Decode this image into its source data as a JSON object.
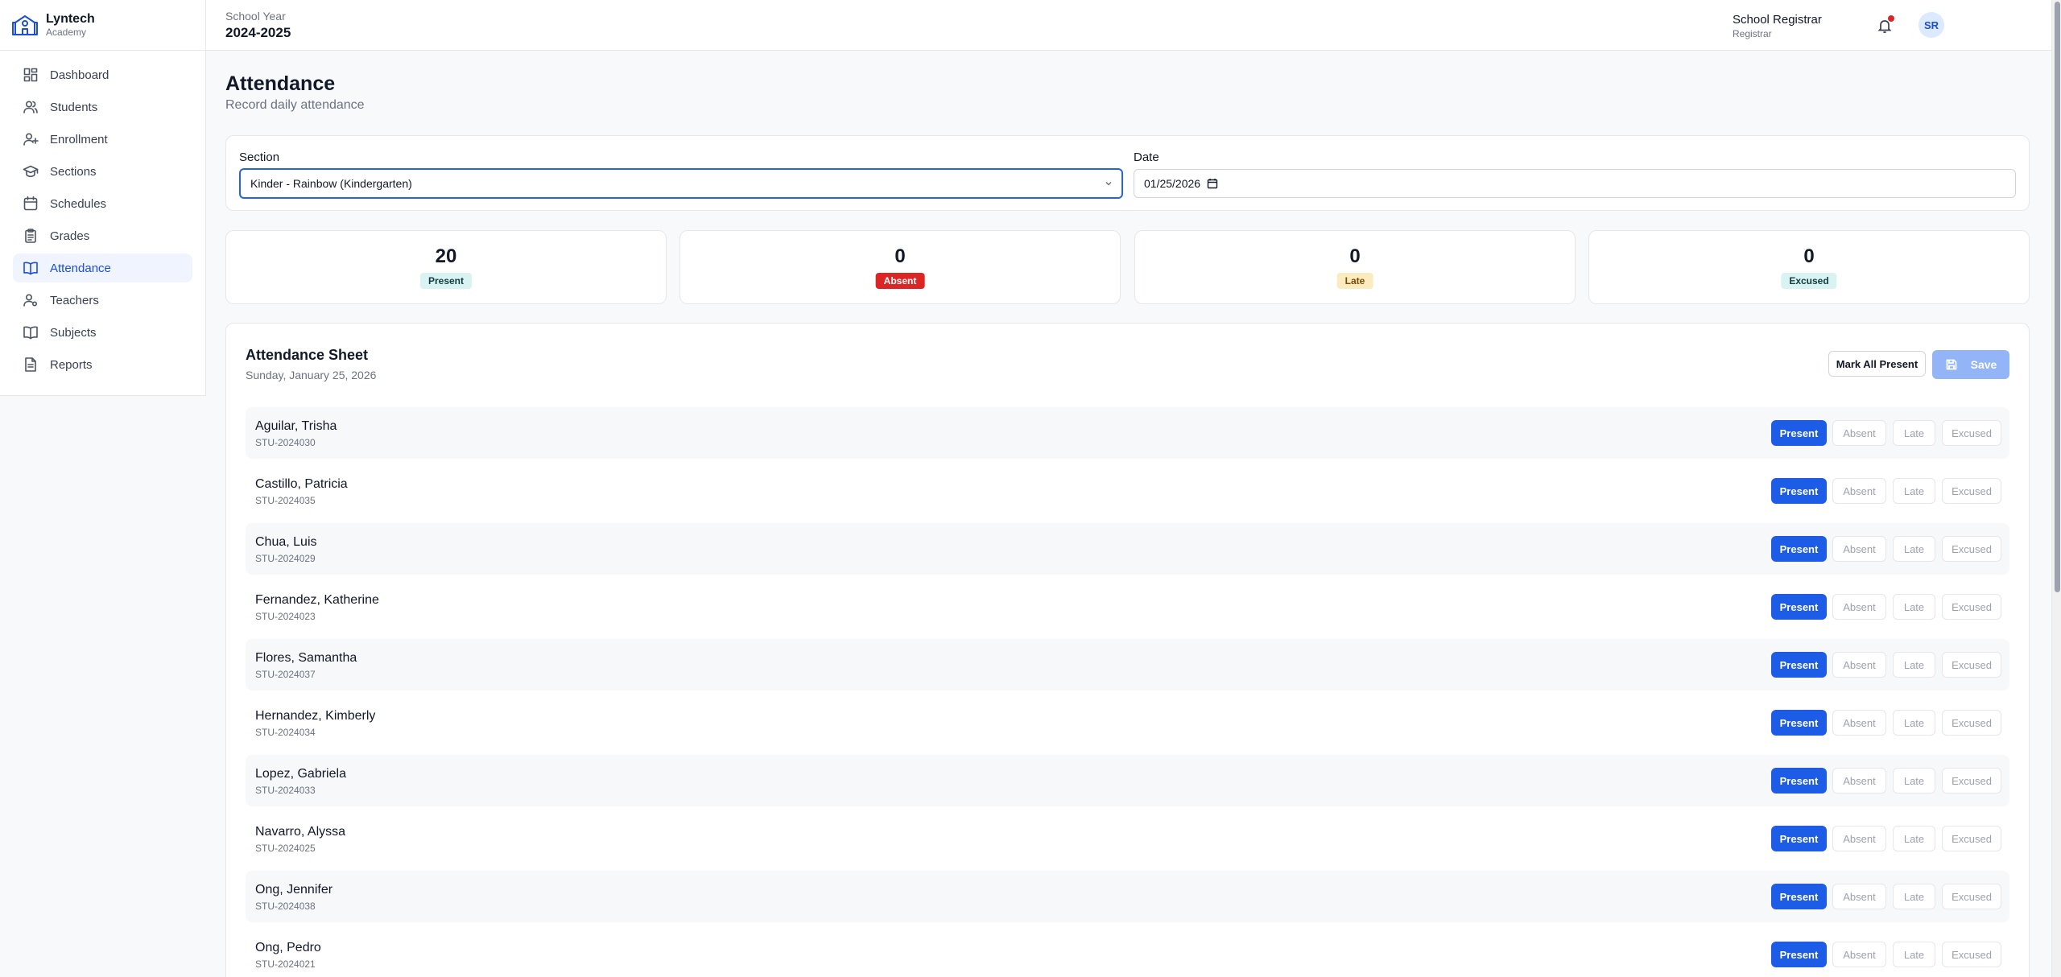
{
  "brand": {
    "name": "Lyntech",
    "sub": "Academy"
  },
  "sidebar": {
    "items": [
      {
        "label": "Dashboard",
        "icon": "dashboard-icon"
      },
      {
        "label": "Students",
        "icon": "users-icon"
      },
      {
        "label": "Enrollment",
        "icon": "user-plus-icon"
      },
      {
        "label": "Sections",
        "icon": "graduation-cap-icon"
      },
      {
        "label": "Schedules",
        "icon": "calendar-icon"
      },
      {
        "label": "Grades",
        "icon": "clipboard-icon"
      },
      {
        "label": "Attendance",
        "icon": "book-open-icon",
        "active": true
      },
      {
        "label": "Teachers",
        "icon": "user-cog-icon"
      },
      {
        "label": "Subjects",
        "icon": "book-icon"
      },
      {
        "label": "Reports",
        "icon": "file-text-icon"
      }
    ]
  },
  "header": {
    "school_year_label": "School Year",
    "school_year": "2024-2025",
    "user_initials": "SR",
    "user_name": "School Registrar",
    "user_role": "Registrar"
  },
  "page": {
    "title": "Attendance",
    "subtitle": "Record daily attendance"
  },
  "filters": {
    "section_label": "Section",
    "section_value": "Kinder - Rainbow (Kindergarten)",
    "date_label": "Date",
    "date_value": "01/25/2026"
  },
  "stats": [
    {
      "value": "20",
      "label": "Present",
      "bg": "#d9f2f2",
      "fg": "#0f3d3d"
    },
    {
      "value": "0",
      "label": "Absent",
      "bg": "#dc2626",
      "fg": "#ffffff"
    },
    {
      "value": "0",
      "label": "Late",
      "bg": "#fdebc0",
      "fg": "#7c4a03"
    },
    {
      "value": "0",
      "label": "Excused",
      "bg": "#d9f2f2",
      "fg": "#0f3d3d"
    }
  ],
  "sheet": {
    "title": "Attendance Sheet",
    "date": "Sunday, January 25, 2026",
    "mark_all_label": "Mark All Present",
    "save_label": "Save",
    "status_labels": {
      "present": "Present",
      "absent": "Absent",
      "late": "Late",
      "excused": "Excused"
    },
    "students": [
      {
        "name": "Aguilar, Trisha",
        "id": "STU-2024030"
      },
      {
        "name": "Castillo, Patricia",
        "id": "STU-2024035"
      },
      {
        "name": "Chua, Luis",
        "id": "STU-2024029"
      },
      {
        "name": "Fernandez, Katherine",
        "id": "STU-2024023"
      },
      {
        "name": "Flores, Samantha",
        "id": "STU-2024037"
      },
      {
        "name": "Hernandez, Kimberly",
        "id": "STU-2024034"
      },
      {
        "name": "Lopez, Gabriela",
        "id": "STU-2024033"
      },
      {
        "name": "Navarro, Alyssa",
        "id": "STU-2024025"
      },
      {
        "name": "Ong, Jennifer",
        "id": "STU-2024038"
      },
      {
        "name": "Ong, Pedro",
        "id": "STU-2024021"
      }
    ]
  }
}
